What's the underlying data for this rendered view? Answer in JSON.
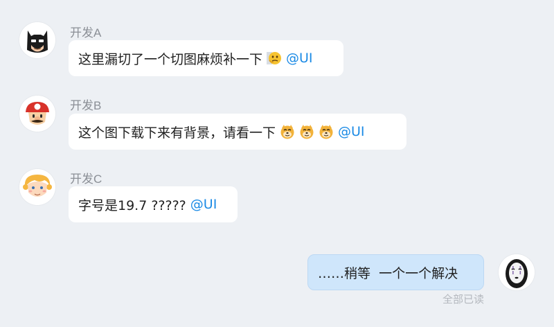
{
  "messages": [
    {
      "sender": "开发A",
      "avatar": "batman-avatar",
      "text": "这里漏切了一个切图麻烦补一下",
      "emojis": [
        "thinking-face-emoji"
      ],
      "mention": "@UI"
    },
    {
      "sender": "开发B",
      "avatar": "mario-avatar",
      "text": "这个图下载下来有背景，请看一下",
      "emojis": [
        "doge-emoji",
        "doge-emoji",
        "doge-emoji"
      ],
      "mention": "@UI"
    },
    {
      "sender": "开发C",
      "avatar": "blond-kid-avatar",
      "text": "字号是19.7 ?????",
      "emojis": [],
      "mention": "@UI"
    }
  ],
  "reply": {
    "avatar": "no-face-avatar",
    "text": "……稍等  一个一个解决",
    "status": "全部已读"
  },
  "colors": {
    "background": "#edf0f4",
    "incoming_bubble": "#ffffff",
    "outgoing_bubble": "#cfe6fb",
    "mention": "#1a8ae5",
    "sender_name": "#8b8f96",
    "status_text": "#b4b8be"
  }
}
